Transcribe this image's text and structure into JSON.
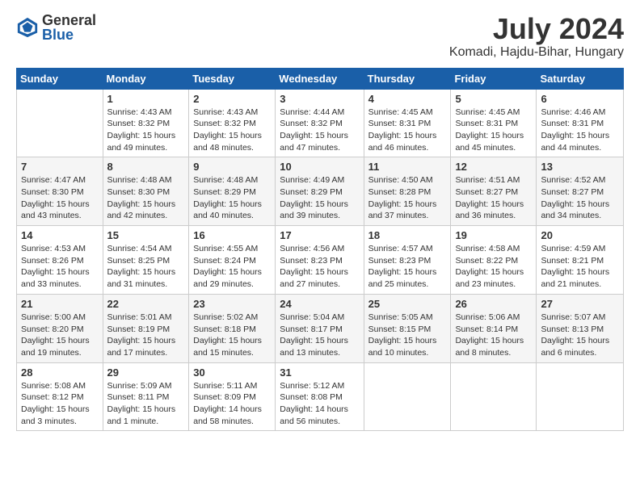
{
  "logo": {
    "general": "General",
    "blue": "Blue"
  },
  "title": {
    "month_year": "July 2024",
    "location": "Komadi, Hajdu-Bihar, Hungary"
  },
  "days_of_week": [
    "Sunday",
    "Monday",
    "Tuesday",
    "Wednesday",
    "Thursday",
    "Friday",
    "Saturday"
  ],
  "weeks": [
    [
      {
        "day": "",
        "info": ""
      },
      {
        "day": "1",
        "info": "Sunrise: 4:43 AM\nSunset: 8:32 PM\nDaylight: 15 hours\nand 49 minutes."
      },
      {
        "day": "2",
        "info": "Sunrise: 4:43 AM\nSunset: 8:32 PM\nDaylight: 15 hours\nand 48 minutes."
      },
      {
        "day": "3",
        "info": "Sunrise: 4:44 AM\nSunset: 8:32 PM\nDaylight: 15 hours\nand 47 minutes."
      },
      {
        "day": "4",
        "info": "Sunrise: 4:45 AM\nSunset: 8:31 PM\nDaylight: 15 hours\nand 46 minutes."
      },
      {
        "day": "5",
        "info": "Sunrise: 4:45 AM\nSunset: 8:31 PM\nDaylight: 15 hours\nand 45 minutes."
      },
      {
        "day": "6",
        "info": "Sunrise: 4:46 AM\nSunset: 8:31 PM\nDaylight: 15 hours\nand 44 minutes."
      }
    ],
    [
      {
        "day": "7",
        "info": "Sunrise: 4:47 AM\nSunset: 8:30 PM\nDaylight: 15 hours\nand 43 minutes."
      },
      {
        "day": "8",
        "info": "Sunrise: 4:48 AM\nSunset: 8:30 PM\nDaylight: 15 hours\nand 42 minutes."
      },
      {
        "day": "9",
        "info": "Sunrise: 4:48 AM\nSunset: 8:29 PM\nDaylight: 15 hours\nand 40 minutes."
      },
      {
        "day": "10",
        "info": "Sunrise: 4:49 AM\nSunset: 8:29 PM\nDaylight: 15 hours\nand 39 minutes."
      },
      {
        "day": "11",
        "info": "Sunrise: 4:50 AM\nSunset: 8:28 PM\nDaylight: 15 hours\nand 37 minutes."
      },
      {
        "day": "12",
        "info": "Sunrise: 4:51 AM\nSunset: 8:27 PM\nDaylight: 15 hours\nand 36 minutes."
      },
      {
        "day": "13",
        "info": "Sunrise: 4:52 AM\nSunset: 8:27 PM\nDaylight: 15 hours\nand 34 minutes."
      }
    ],
    [
      {
        "day": "14",
        "info": "Sunrise: 4:53 AM\nSunset: 8:26 PM\nDaylight: 15 hours\nand 33 minutes."
      },
      {
        "day": "15",
        "info": "Sunrise: 4:54 AM\nSunset: 8:25 PM\nDaylight: 15 hours\nand 31 minutes."
      },
      {
        "day": "16",
        "info": "Sunrise: 4:55 AM\nSunset: 8:24 PM\nDaylight: 15 hours\nand 29 minutes."
      },
      {
        "day": "17",
        "info": "Sunrise: 4:56 AM\nSunset: 8:23 PM\nDaylight: 15 hours\nand 27 minutes."
      },
      {
        "day": "18",
        "info": "Sunrise: 4:57 AM\nSunset: 8:23 PM\nDaylight: 15 hours\nand 25 minutes."
      },
      {
        "day": "19",
        "info": "Sunrise: 4:58 AM\nSunset: 8:22 PM\nDaylight: 15 hours\nand 23 minutes."
      },
      {
        "day": "20",
        "info": "Sunrise: 4:59 AM\nSunset: 8:21 PM\nDaylight: 15 hours\nand 21 minutes."
      }
    ],
    [
      {
        "day": "21",
        "info": "Sunrise: 5:00 AM\nSunset: 8:20 PM\nDaylight: 15 hours\nand 19 minutes."
      },
      {
        "day": "22",
        "info": "Sunrise: 5:01 AM\nSunset: 8:19 PM\nDaylight: 15 hours\nand 17 minutes."
      },
      {
        "day": "23",
        "info": "Sunrise: 5:02 AM\nSunset: 8:18 PM\nDaylight: 15 hours\nand 15 minutes."
      },
      {
        "day": "24",
        "info": "Sunrise: 5:04 AM\nSunset: 8:17 PM\nDaylight: 15 hours\nand 13 minutes."
      },
      {
        "day": "25",
        "info": "Sunrise: 5:05 AM\nSunset: 8:15 PM\nDaylight: 15 hours\nand 10 minutes."
      },
      {
        "day": "26",
        "info": "Sunrise: 5:06 AM\nSunset: 8:14 PM\nDaylight: 15 hours\nand 8 minutes."
      },
      {
        "day": "27",
        "info": "Sunrise: 5:07 AM\nSunset: 8:13 PM\nDaylight: 15 hours\nand 6 minutes."
      }
    ],
    [
      {
        "day": "28",
        "info": "Sunrise: 5:08 AM\nSunset: 8:12 PM\nDaylight: 15 hours\nand 3 minutes."
      },
      {
        "day": "29",
        "info": "Sunrise: 5:09 AM\nSunset: 8:11 PM\nDaylight: 15 hours\nand 1 minute."
      },
      {
        "day": "30",
        "info": "Sunrise: 5:11 AM\nSunset: 8:09 PM\nDaylight: 14 hours\nand 58 minutes."
      },
      {
        "day": "31",
        "info": "Sunrise: 5:12 AM\nSunset: 8:08 PM\nDaylight: 14 hours\nand 56 minutes."
      },
      {
        "day": "",
        "info": ""
      },
      {
        "day": "",
        "info": ""
      },
      {
        "day": "",
        "info": ""
      }
    ]
  ]
}
